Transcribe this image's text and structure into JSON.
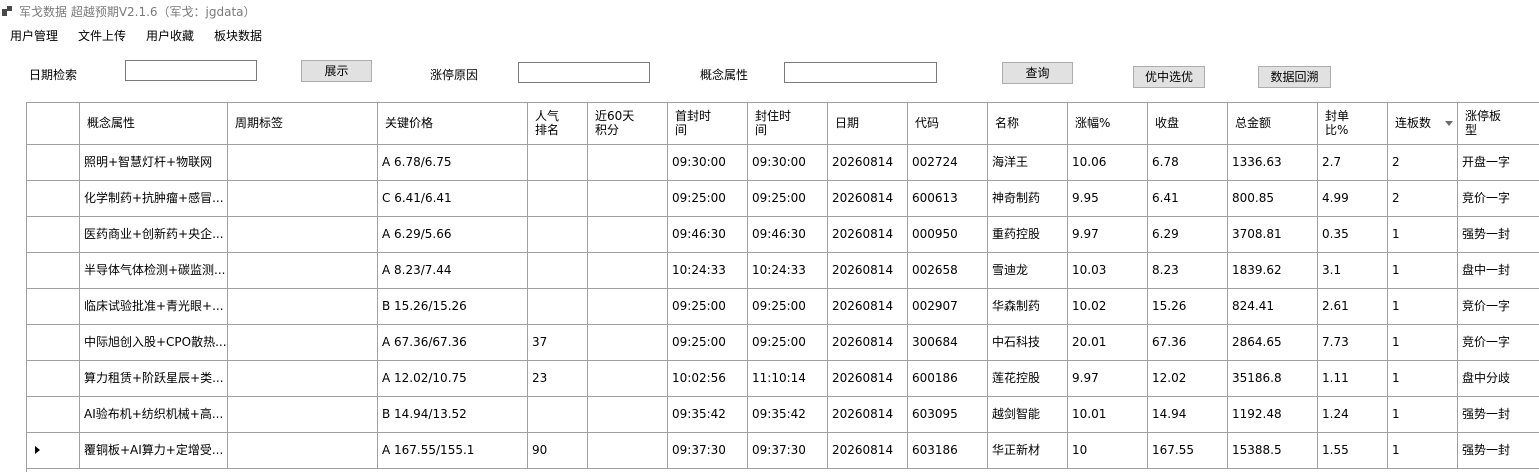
{
  "window": {
    "title": "军戈数据 超越预期V2.1.6（军戈：jgdata）"
  },
  "menu": [
    "用户管理",
    "文件上传",
    "用户收藏",
    "板块数据"
  ],
  "filters": {
    "date_label": "日期检索",
    "date_value": "",
    "show_button": "展示",
    "reason_label": "涨停原因",
    "reason_value": "",
    "concept_label": "概念属性",
    "concept_value": "",
    "query_button": "查询",
    "pick_button": "优中选优",
    "backtest_button": "数据回溯"
  },
  "table": {
    "headers": [
      "概念属性",
      "周期标签",
      "关键价格",
      "人气\n排名",
      "近60天\n积分",
      "首封时\n间",
      "封住时\n间",
      "日期",
      "代码",
      "名称",
      "涨幅%",
      "收盘",
      "总金额",
      "封单\n比%",
      "连板数",
      "涨停板\n型"
    ],
    "rows": [
      [
        "照明+智慧灯杆+物联网",
        "",
        "A 6.78/6.75",
        "",
        "",
        "09:30:00",
        "09:30:00",
        "20260814",
        "002724",
        "海洋王",
        "10.06",
        "6.78",
        "1336.63",
        "2.7",
        "2",
        "开盘一字"
      ],
      [
        "化学制药+抗肿瘤+感冒...",
        "",
        "C 6.41/6.41",
        "",
        "",
        "09:25:00",
        "09:25:00",
        "20260814",
        "600613",
        "神奇制药",
        "9.95",
        "6.41",
        "800.85",
        "4.99",
        "2",
        "竞价一字"
      ],
      [
        "医药商业+创新药+央企...",
        "",
        "A 6.29/5.66",
        "",
        "",
        "09:46:30",
        "09:46:30",
        "20260814",
        "000950",
        "重药控股",
        "9.97",
        "6.29",
        "3708.81",
        "0.35",
        "1",
        "强势一封"
      ],
      [
        "半导体气体检测+碳监测...",
        "",
        "A 8.23/7.44",
        "",
        "",
        "10:24:33",
        "10:24:33",
        "20260814",
        "002658",
        "雪迪龙",
        "10.03",
        "8.23",
        "1839.62",
        "3.1",
        "1",
        "盘中一封"
      ],
      [
        "临床试验批准+青光眼+...",
        "",
        "B 15.26/15.26",
        "",
        "",
        "09:25:00",
        "09:25:00",
        "20260814",
        "002907",
        "华森制药",
        "10.02",
        "15.26",
        "824.41",
        "2.61",
        "1",
        "竞价一字"
      ],
      [
        "中际旭创入股+CPO散热...",
        "",
        "A 67.36/67.36",
        "37",
        "",
        "09:25:00",
        "09:25:00",
        "20260814",
        "300684",
        "中石科技",
        "20.01",
        "67.36",
        "2864.65",
        "7.73",
        "1",
        "竞价一字"
      ],
      [
        "算力租赁+阶跃星辰+类...",
        "",
        "A 12.02/10.75",
        "23",
        "",
        "10:02:56",
        "11:10:14",
        "20260814",
        "600186",
        "莲花控股",
        "9.97",
        "12.02",
        "35186.8",
        "1.11",
        "1",
        "盘中分歧"
      ],
      [
        "AI验布机+纺织机械+高...",
        "",
        "B 14.94/13.52",
        "",
        "",
        "09:35:42",
        "09:35:42",
        "20260814",
        "603095",
        "越剑智能",
        "10.01",
        "14.94",
        "1192.48",
        "1.24",
        "1",
        "强势一封"
      ],
      [
        "覆铜板+AI算力+定增受...",
        "",
        "A 167.55/155.1",
        "90",
        "",
        "09:37:30",
        "09:37:30",
        "20260814",
        "603186",
        "华正新材",
        "10",
        "167.55",
        "15388.5",
        "1.55",
        "1",
        "强势一封"
      ]
    ]
  }
}
